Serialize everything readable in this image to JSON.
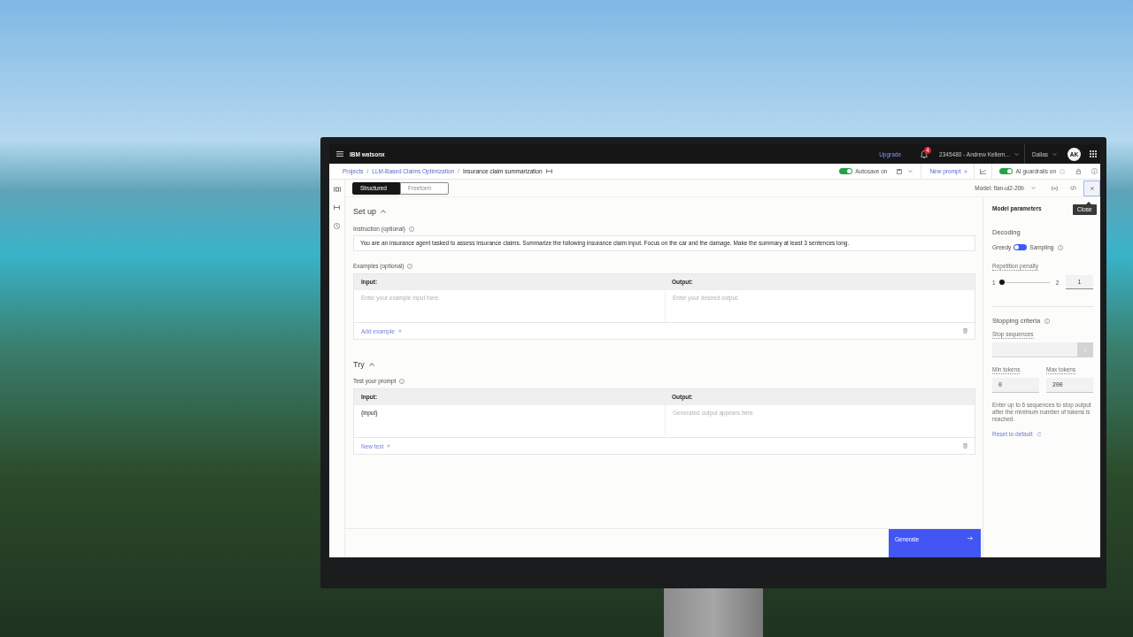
{
  "header": {
    "product": "IBM watsonx",
    "upgrade": "Upgrade",
    "notification_count": "4",
    "account": "2345480 - Andrew Kellem...",
    "region": "Dallas",
    "avatar": "AK"
  },
  "breadcrumbs": [
    {
      "label": "Projects",
      "kind": "link"
    },
    {
      "label": "LLM-Based Claims Optimization",
      "kind": "link",
      "separator": "/"
    },
    {
      "label": "Insurance claim summarization",
      "kind": "current",
      "separator": "/"
    }
  ],
  "prompt_bar": {
    "autosave": {
      "label": "Autosave on",
      "on": true
    },
    "new_prompt": "New prompt",
    "guardrails": {
      "label": "AI guardrails on",
      "on": true
    }
  },
  "mode_tabs": [
    {
      "label": "Structured",
      "selected": true
    },
    {
      "label": "Freeform",
      "selected": false
    }
  ],
  "model_selector": "Model: flan-ul2-20b",
  "close_tooltip": "Close",
  "setup": {
    "title": "Set up",
    "expanded": true,
    "instruction_label": "Instruction (optional)",
    "instruction": "You are an insurance agent tasked to assess insurance claims. Summarize the following insurance claim input. Focus on the car and the damage. Make the summary at least 3 sentences long.",
    "examples_label": "Examples (optional)",
    "columns": [
      "Input:",
      "Output:"
    ],
    "cells": [
      {
        "placeholder": "Enter your example input here."
      },
      {
        "placeholder": "Enter your desired output."
      }
    ],
    "add": "Add example"
  },
  "try": {
    "title": "Try",
    "expanded": true,
    "test_label": "Test your prompt",
    "columns": [
      "Input:",
      "Output:"
    ],
    "cells": [
      {
        "value": "{input}"
      },
      {
        "placeholder": "Generated output appears here."
      }
    ],
    "add": "New test"
  },
  "generate": "Generate",
  "parameters": {
    "title": "Model parameters",
    "decoding": {
      "title": "Decoding",
      "left": "Greedy",
      "right": "Sampling",
      "on": false
    },
    "repetition_penalty": {
      "label": "Repetition penalty",
      "min": "1",
      "max": "2",
      "level": 0,
      "value": "1"
    },
    "stopping": {
      "title": "Stopping criteria",
      "sequences_label": "Stop sequences",
      "min_tokens": {
        "label": "Min tokens",
        "value": "0"
      },
      "max_tokens": {
        "label": "Max tokens",
        "value": "200"
      },
      "help": "Enter up to 6 sequences to stop output after the minimum number of tokens is reached.",
      "reset": "Reset to default"
    }
  }
}
